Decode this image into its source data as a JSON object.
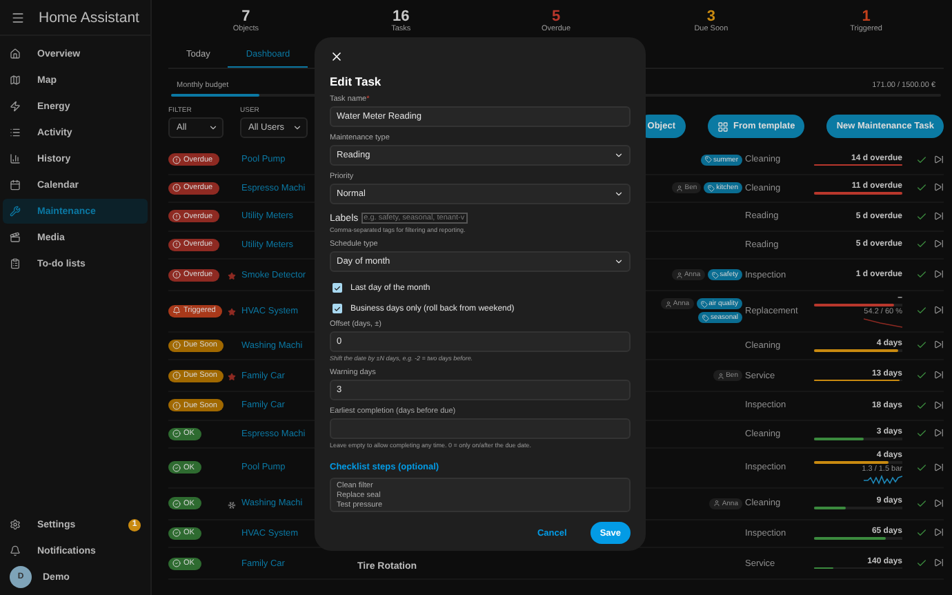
{
  "app_title": "Home Assistant",
  "sidebar": {
    "items": [
      {
        "label": "Overview",
        "selected": false
      },
      {
        "label": "Map",
        "selected": false
      },
      {
        "label": "Energy",
        "selected": false
      },
      {
        "label": "Activity",
        "selected": false
      },
      {
        "label": "History",
        "selected": false
      },
      {
        "label": "Calendar",
        "selected": false
      },
      {
        "label": "Maintenance",
        "selected": true
      },
      {
        "label": "Media",
        "selected": false
      },
      {
        "label": "To-do lists",
        "selected": false
      }
    ],
    "settings": {
      "label": "Settings",
      "badge": "1"
    },
    "notifications": {
      "label": "Notifications"
    },
    "user": {
      "initial": "D",
      "name": "Demo"
    }
  },
  "stats": [
    {
      "value": "7",
      "label": "Objects",
      "color": "#c8c8c8"
    },
    {
      "value": "16",
      "label": "Tasks",
      "color": "#c8c8c8"
    },
    {
      "value": "5",
      "label": "Overdue",
      "color": "#b8372c"
    },
    {
      "value": "3",
      "label": "Due Soon",
      "color": "#c98a10"
    },
    {
      "value": "1",
      "label": "Triggered",
      "color": "#c2401c"
    }
  ],
  "tabs": [
    {
      "label": "Today",
      "selected": false
    },
    {
      "label": "Dashboard",
      "selected": true
    }
  ],
  "budget": {
    "label": "Monthly budget",
    "amount": "171.00 / 1500.00 €",
    "level": 0.114
  },
  "filters": [
    {
      "label": "FILTER",
      "value": "All"
    },
    {
      "label": "USER",
      "value": "All Users"
    }
  ],
  "actions": [
    {
      "label": "Object",
      "kind": "text"
    },
    {
      "label": "From template",
      "kind": "template"
    },
    {
      "label": "New Maintenance Task",
      "kind": "text"
    }
  ],
  "rows": [
    {
      "kind": "overdue",
      "status_label": "Overdue",
      "starred": false,
      "snoozed": false,
      "object": "Pool Pump",
      "users": [],
      "tags": [
        "summer"
      ],
      "type": "Cleaning",
      "due": "14 d overdue",
      "bar": {
        "color": "#b8372c",
        "level": 1
      }
    },
    {
      "kind": "overdue",
      "status_label": "Overdue",
      "starred": false,
      "snoozed": false,
      "object": "Espresso Machi",
      "users": [
        "Ben"
      ],
      "tags": [
        "kitchen"
      ],
      "type": "Cleaning",
      "due": "11 d overdue",
      "bar": {
        "color": "#b8372c",
        "level": 1
      }
    },
    {
      "kind": "overdue",
      "status_label": "Overdue",
      "starred": false,
      "snoozed": false,
      "object": "Utility Meters",
      "users": [],
      "tags": [],
      "type": "Reading",
      "due": "5 d overdue"
    },
    {
      "kind": "overdue",
      "status_label": "Overdue",
      "starred": false,
      "snoozed": false,
      "object": "Utility Meters",
      "users": [],
      "tags": [],
      "type": "Reading",
      "due": "5 d overdue"
    },
    {
      "kind": "overdue",
      "status_label": "Overdue",
      "starred": true,
      "snoozed": false,
      "object": "Smoke Detector",
      "users": [
        "Anna"
      ],
      "tags": [
        "safety"
      ],
      "type": "Inspection",
      "due": "1 d overdue"
    },
    {
      "kind": "triggered",
      "status_label": "Triggered",
      "starred": true,
      "snoozed": false,
      "object": "HVAC System",
      "users": [
        "Anna"
      ],
      "tags": [
        "air quality",
        "seasonal"
      ],
      "type": "Replacement",
      "due": "–",
      "bar": {
        "color": "#b8372c",
        "level": 0.9
      },
      "sensor": {
        "kind": "falling",
        "reading": "54.2 / 60 %"
      }
    },
    {
      "kind": "soon",
      "status_label": "Due Soon",
      "starred": false,
      "snoozed": false,
      "object": "Washing Machi",
      "users": [],
      "tags": [],
      "type": "Cleaning",
      "due": "4 days",
      "bar": {
        "color": "#c98a10",
        "level": 0.96
      }
    },
    {
      "kind": "soon",
      "status_label": "Due Soon",
      "starred": true,
      "snoozed": false,
      "object": "Family Car",
      "users": [
        "Ben"
      ],
      "tags": [],
      "type": "Service",
      "due": "13 days",
      "bar": {
        "color": "#c98a10",
        "level": 0.97
      }
    },
    {
      "kind": "soon",
      "status_label": "Due Soon",
      "starred": false,
      "snoozed": false,
      "object": "Family Car",
      "users": [],
      "tags": [],
      "type": "Inspection",
      "due": "18 days"
    },
    {
      "kind": "ok",
      "status_label": "OK",
      "starred": false,
      "snoozed": false,
      "object": "Espresso Machi",
      "users": [],
      "tags": [],
      "type": "Cleaning",
      "due": "3 days",
      "bar": {
        "color": "#3b8a3e",
        "level": 0.57
      }
    },
    {
      "kind": "ok",
      "status_label": "OK",
      "starred": false,
      "snoozed": false,
      "object": "Pool Pump",
      "users": [],
      "tags": [],
      "type": "Inspection",
      "due": "4 days",
      "bar": {
        "color": "#c98a10",
        "level": 0.85
      },
      "sensor": {
        "kind": "wave",
        "reading": "1.3 / 1.5 bar"
      }
    },
    {
      "kind": "ok",
      "status_label": "OK",
      "starred": false,
      "snoozed": true,
      "object": "Washing Machi",
      "users": [
        "Anna"
      ],
      "tags": [],
      "type": "Cleaning",
      "due": "9 days",
      "bar": {
        "color": "#3b8a3e",
        "level": 0.36
      }
    },
    {
      "kind": "ok",
      "status_label": "OK",
      "starred": false,
      "snoozed": false,
      "object": "HVAC System",
      "users": [],
      "tags": [],
      "type": "Inspection",
      "due": "65 days",
      "bar": {
        "color": "#3b8a3e",
        "level": 0.82
      }
    },
    {
      "kind": "ok",
      "status_label": "OK",
      "starred": false,
      "snoozed": false,
      "object": "Family Car",
      "task": "Tire Rotation",
      "users": [],
      "tags": [],
      "type": "Service",
      "due": "140 days",
      "bar": {
        "color": "#3b8a3e",
        "level": 0.22
      }
    }
  ],
  "dialog": {
    "title": "Edit Task",
    "fields": [
      {
        "kind": "input",
        "label": "Task name",
        "required_mark": "*",
        "value": "Water Meter Reading"
      },
      {
        "kind": "select",
        "label": "Maintenance type",
        "value": "Reading"
      },
      {
        "kind": "select",
        "label": "Priority",
        "value": "Normal"
      },
      {
        "kind": "labels",
        "label": "Labels",
        "placeholder": "e.g. safety, seasonal, tenant-v",
        "hint": "Comma-separated tags for filtering and reporting."
      },
      {
        "kind": "select",
        "label": "Schedule type",
        "value": "Day of month"
      },
      {
        "kind": "checkbox",
        "label": "Last day of the month",
        "checked": true
      },
      {
        "kind": "checkbox",
        "label": "Business days only (roll back from weekend)",
        "checked": true
      },
      {
        "kind": "input",
        "label": "Offset (days, ±)",
        "value": "0",
        "hint": "Shift the date by ±N days, e.g. -2 = two days before."
      },
      {
        "kind": "input",
        "label": "Warning days",
        "value": "3"
      },
      {
        "kind": "input",
        "label": "Earliest completion (days before due)",
        "hint": "Leave empty to allow completing any time. 0 = only on/after the due date."
      }
    ],
    "checklist": {
      "title": "Checklist steps (optional)",
      "value": "Clean filter\nReplace seal\nTest pressure"
    },
    "buttons": [
      {
        "label": "Cancel",
        "kind": "text"
      },
      {
        "label": "Save",
        "kind": "primary"
      }
    ]
  }
}
